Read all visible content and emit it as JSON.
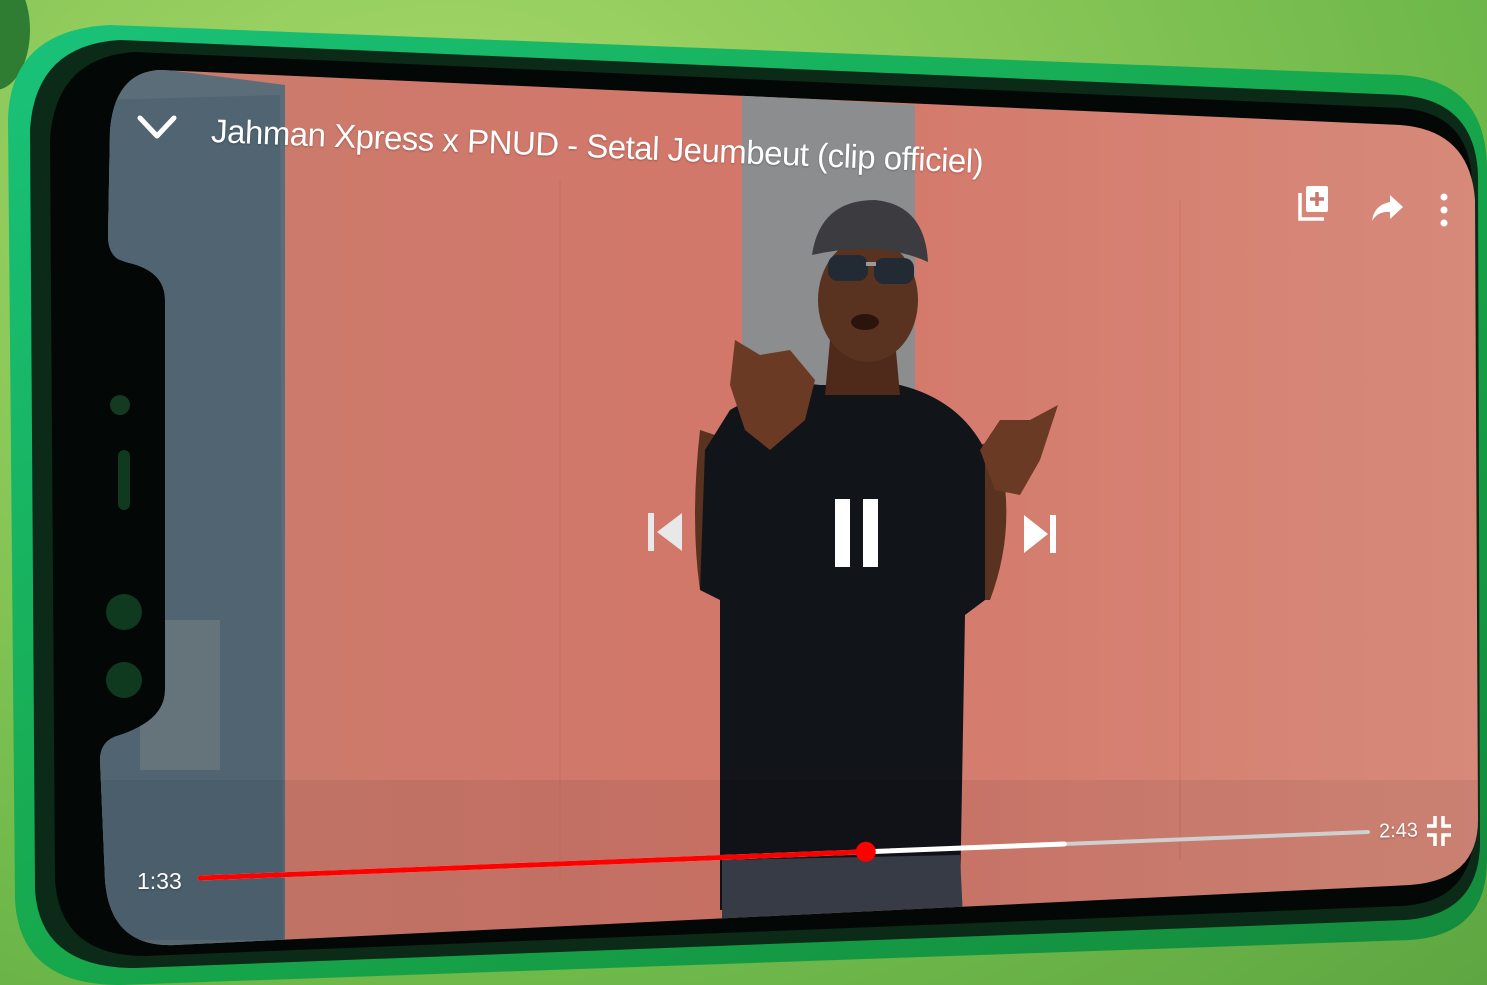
{
  "video": {
    "title": "Jahman Xpress x PNUD - Setal Jeumbeut (clip officiel)",
    "current_time": "1:33",
    "duration": "2:43",
    "progress_fraction": 0.57,
    "buffered_fraction": 0.74
  },
  "controls": {
    "minimize": "chevron-down-icon",
    "add_to_playlist": "playlist-add-icon",
    "share": "share-arrow-icon",
    "more": "more-vert-icon",
    "previous": "skip-previous-icon",
    "play_pause": "pause-icon",
    "next": "skip-next-icon",
    "exit_fullscreen": "fullscreen-exit-icon"
  },
  "colors": {
    "progress_played": "#ff0000",
    "progress_buffered": "#ffffff",
    "progress_remaining": "#cfcfcf",
    "phone_frame": "#1a9e4a"
  }
}
